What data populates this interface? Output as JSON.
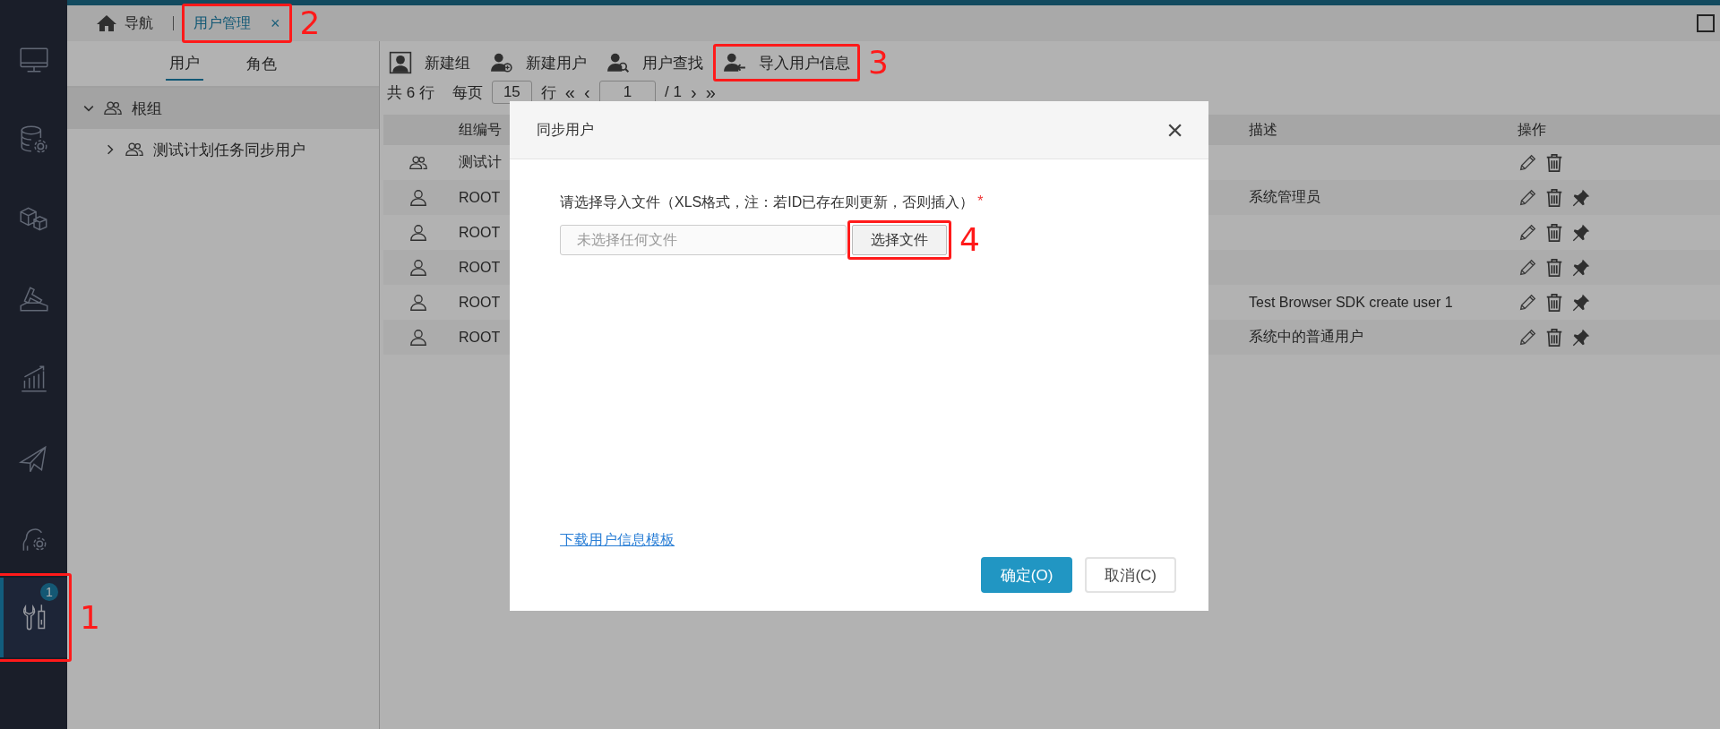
{
  "sidebar": {
    "items": [
      {
        "kind": "monitor",
        "selected": false
      },
      {
        "kind": "database",
        "selected": false
      },
      {
        "kind": "cubes",
        "selected": false
      },
      {
        "kind": "hammer",
        "selected": false
      },
      {
        "kind": "chart",
        "selected": false
      },
      {
        "kind": "plane",
        "selected": false
      },
      {
        "kind": "person-gear",
        "selected": false
      },
      {
        "kind": "tools",
        "selected": true,
        "badge": "1",
        "annotation": "1"
      }
    ]
  },
  "tabs": [
    {
      "kind": "home",
      "label": "导航",
      "selected": false
    },
    {
      "kind": "page",
      "label": "用户管理",
      "selected": true,
      "close": "×",
      "annotation": "2"
    }
  ],
  "left_panel": {
    "tabs": [
      {
        "label": "用户",
        "selected": true
      },
      {
        "label": "角色",
        "selected": false
      }
    ],
    "tree": [
      {
        "label": "根组",
        "expanded": true,
        "selected": true,
        "children": [
          {
            "label": "测试计划任务同步用户",
            "expanded": false,
            "selected": false
          }
        ]
      }
    ]
  },
  "toolbar": [
    {
      "kind": "group",
      "label": "新建组"
    },
    {
      "kind": "add-user",
      "label": "新建用户"
    },
    {
      "kind": "find-user",
      "label": "用户查找"
    },
    {
      "kind": "import",
      "label": "导入用户信息",
      "annotation": "3"
    }
  ],
  "pagination": {
    "total_prefix": "共",
    "total": "6",
    "total_suffix": "行",
    "per_page_label": "每页",
    "per_page": "15",
    "per_page_suffix": "行",
    "first": "«",
    "prev": "‹",
    "page": "1",
    "separator": "/",
    "pages": "1",
    "next": "›",
    "last": "»"
  },
  "table": {
    "columns": [
      {
        "label": "组编号"
      },
      {
        "label": "描述"
      },
      {
        "label": "操作"
      }
    ],
    "rows": [
      {
        "kind": "group",
        "code": "测试计",
        "actions": [
          {
            "kind": "edit"
          },
          {
            "kind": "delete"
          }
        ]
      },
      {
        "kind": "user",
        "code": "ROOT",
        "description": "系统管理员",
        "actions": [
          {
            "kind": "edit"
          },
          {
            "kind": "delete"
          },
          {
            "kind": "pin"
          }
        ]
      },
      {
        "kind": "user",
        "code": "ROOT",
        "actions": [
          {
            "kind": "edit"
          },
          {
            "kind": "delete"
          },
          {
            "kind": "pin"
          }
        ]
      },
      {
        "kind": "user",
        "code": "ROOT",
        "actions": [
          {
            "kind": "edit"
          },
          {
            "kind": "delete"
          },
          {
            "kind": "pin"
          }
        ]
      },
      {
        "kind": "user",
        "code": "ROOT",
        "description": "Test Browser SDK create user 1",
        "actions": [
          {
            "kind": "edit"
          },
          {
            "kind": "delete"
          },
          {
            "kind": "pin"
          }
        ]
      },
      {
        "kind": "user",
        "code": "ROOT",
        "description": "系统中的普通用户",
        "actions": [
          {
            "kind": "edit"
          },
          {
            "kind": "delete"
          },
          {
            "kind": "pin"
          }
        ]
      }
    ]
  },
  "dialog": {
    "title": "同步用户",
    "close": "×",
    "prompt": "请选择导入文件（XLS格式，注：若ID已存在则更新，否则插入）",
    "required_mark": "*",
    "file_placeholder": "未选择任何文件",
    "choose_button": {
      "label": "选择文件",
      "annotation": "4"
    },
    "template_link": "下载用户信息模板",
    "buttons": [
      {
        "kind": "primary",
        "label": "确定(O)"
      },
      {
        "kind": "default",
        "label": "取消(C)"
      }
    ]
  }
}
